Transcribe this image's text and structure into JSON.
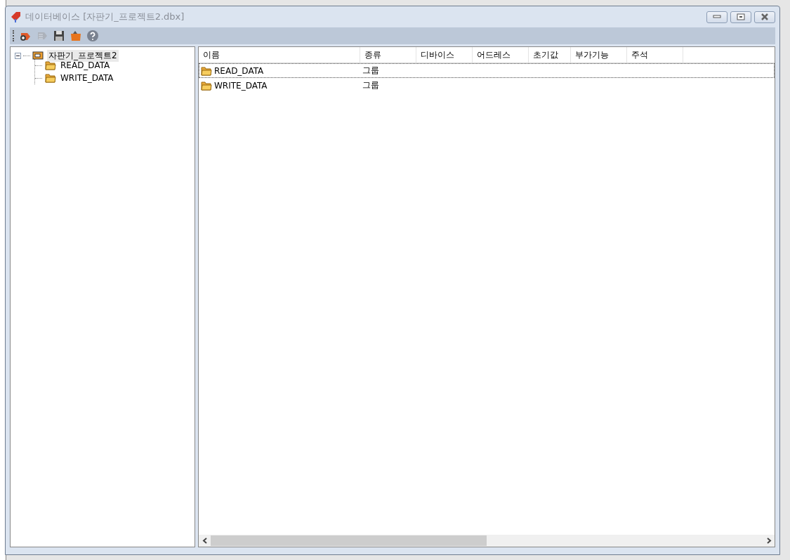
{
  "window": {
    "title": "데이터베이스 [자판기_프로젝트2.dbx]"
  },
  "toolbar": {
    "buttons": [
      {
        "kind": "add",
        "disabled": false
      },
      {
        "kind": "list",
        "disabled": true
      },
      {
        "kind": "save",
        "disabled": false
      },
      {
        "kind": "open",
        "disabled": false
      },
      {
        "kind": "help",
        "disabled": false
      }
    ]
  },
  "tree": {
    "root": {
      "label": "자판기_프로젝트2",
      "expanded": true,
      "selected": true,
      "children": [
        {
          "label": "READ_DATA",
          "selected": false
        },
        {
          "label": "WRITE_DATA",
          "selected": false
        }
      ]
    }
  },
  "table": {
    "columns": [
      "이름",
      "종류",
      "디바이스",
      "어드레스",
      "초기값",
      "부가기능",
      "주석"
    ],
    "rows": [
      {
        "name": "READ_DATA",
        "type": "그룹",
        "selected": true
      },
      {
        "name": "WRITE_DATA",
        "type": "그룹",
        "selected": false
      }
    ]
  }
}
